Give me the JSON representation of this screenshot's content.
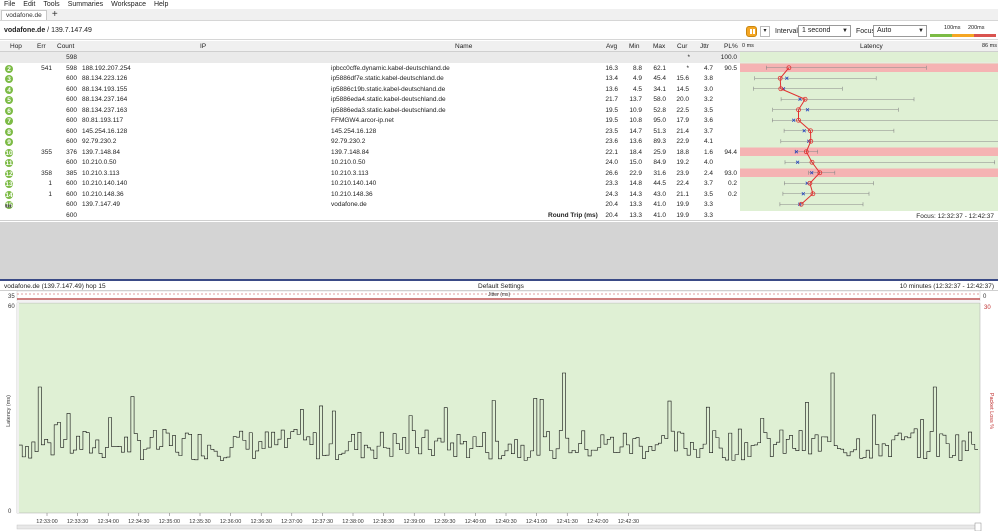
{
  "menu": [
    "File",
    "Edit",
    "Tools",
    "Summaries",
    "Workspace",
    "Help"
  ],
  "tabs": {
    "active": "vodafone.de",
    "add": "+"
  },
  "toolbar": {
    "target_host": "vodafone.de",
    "target_ip": " / 139.7.147.49",
    "pause_dropdown": "▾",
    "interval_label": "Interval",
    "interval_value": "1 second",
    "focus_label": "Focus",
    "focus_value": "Auto",
    "scale_100": "100ms",
    "scale_200": "200ms",
    "colors": {
      "good": "#7cbb45",
      "warn": "#f5a623",
      "bad": "#d9534f"
    }
  },
  "table": {
    "headers": {
      "hop": "Hop",
      "err": "Err",
      "count": "Count",
      "ip": "IP",
      "name": "Name",
      "avg": "Avg",
      "min": "Min",
      "max": "Max",
      "cur": "Cur",
      "jttr": "Jttr",
      "pl": "PL%",
      "latency": "Latency",
      "lat_min": "0 ms",
      "lat_max": "86 ms"
    },
    "first": {
      "count": "598",
      "cur": "*",
      "pl": "100.0"
    },
    "rows": [
      {
        "hop": "2",
        "err": "541",
        "count": "598",
        "ip": "188.192.207.254",
        "name": "ipbcc0cffe.dynamic.kabel-deutschland.de",
        "avg": "16.3",
        "min": "8.8",
        "max": "62.1",
        "cur": "*",
        "jttr": "4.7",
        "pl": "90.5"
      },
      {
        "hop": "3",
        "err": "",
        "count": "600",
        "ip": "88.134.223.126",
        "name": "ip5886df7e.static.kabel-deutschland.de",
        "avg": "13.4",
        "min": "4.9",
        "max": "45.4",
        "cur": "15.6",
        "jttr": "3.8",
        "pl": ""
      },
      {
        "hop": "4",
        "err": "",
        "count": "600",
        "ip": "88.134.193.155",
        "name": "ip5886c19b.static.kabel-deutschland.de",
        "avg": "13.6",
        "min": "4.5",
        "max": "34.1",
        "cur": "14.5",
        "jttr": "3.0",
        "pl": ""
      },
      {
        "hop": "5",
        "err": "",
        "count": "600",
        "ip": "88.134.237.164",
        "name": "ip5886eda4.static.kabel-deutschland.de",
        "avg": "21.7",
        "min": "13.7",
        "max": "58.0",
        "cur": "20.0",
        "jttr": "3.2",
        "pl": ""
      },
      {
        "hop": "6",
        "err": "",
        "count": "600",
        "ip": "88.134.237.163",
        "name": "ip5886eda3.static.kabel-deutschland.de",
        "avg": "19.5",
        "min": "10.9",
        "max": "52.8",
        "cur": "22.5",
        "jttr": "3.5",
        "pl": ""
      },
      {
        "hop": "7",
        "err": "",
        "count": "600",
        "ip": "80.81.193.117",
        "name": "FFMGW4.arcor-ip.net",
        "avg": "19.5",
        "min": "10.8",
        "max": "95.0",
        "cur": "17.9",
        "jttr": "3.6",
        "pl": ""
      },
      {
        "hop": "8",
        "err": "",
        "count": "600",
        "ip": "145.254.16.128",
        "name": "145.254.16.128",
        "avg": "23.5",
        "min": "14.7",
        "max": "51.3",
        "cur": "21.4",
        "jttr": "3.7",
        "pl": ""
      },
      {
        "hop": "9",
        "err": "",
        "count": "600",
        "ip": "92.79.230.2",
        "name": "92.79.230.2",
        "avg": "23.6",
        "min": "13.6",
        "max": "89.3",
        "cur": "22.9",
        "jttr": "4.1",
        "pl": ""
      },
      {
        "hop": "10",
        "err": "355",
        "count": "376",
        "ip": "139.7.148.84",
        "name": "139.7.148.84",
        "avg": "22.1",
        "min": "18.4",
        "max": "25.9",
        "cur": "18.8",
        "jttr": "1.6",
        "pl": "94.4"
      },
      {
        "hop": "11",
        "err": "",
        "count": "600",
        "ip": "10.210.0.50",
        "name": "10.210.0.50",
        "avg": "24.0",
        "min": "15.0",
        "max": "84.9",
        "cur": "19.2",
        "jttr": "4.0",
        "pl": ""
      },
      {
        "hop": "12",
        "err": "358",
        "count": "385",
        "ip": "10.210.3.113",
        "name": "10.210.3.113",
        "avg": "26.6",
        "min": "22.9",
        "max": "31.6",
        "cur": "23.9",
        "jttr": "2.4",
        "pl": "93.0"
      },
      {
        "hop": "13",
        "err": "1",
        "count": "600",
        "ip": "10.210.140.140",
        "name": "10.210.140.140",
        "avg": "23.3",
        "min": "14.8",
        "max": "44.5",
        "cur": "22.4",
        "jttr": "3.7",
        "pl": "0.2"
      },
      {
        "hop": "14",
        "err": "1",
        "count": "600",
        "ip": "10.210.148.36",
        "name": "10.210.148.36",
        "avg": "24.3",
        "min": "14.3",
        "max": "43.0",
        "cur": "21.1",
        "jttr": "3.5",
        "pl": "0.2"
      },
      {
        "hop": "15",
        "err": "",
        "count": "600",
        "ip": "139.7.147.49",
        "name": "vodafone.de",
        "avg": "20.4",
        "min": "13.3",
        "max": "41.0",
        "cur": "19.9",
        "jttr": "3.3",
        "pl": ""
      }
    ],
    "summary": {
      "count": "600",
      "label": "Round Trip (ms)",
      "avg": "20.4",
      "min": "13.3",
      "max": "41.0",
      "cur": "19.9",
      "jttr": "3.3"
    },
    "focus_range": "Focus: 12:32:37 - 12:42:37"
  },
  "graph": {
    "title_left": "vodafone.de (139.7.147.49) hop 15",
    "title_center": "Default Settings",
    "title_right": "10 minutes (12:32:37 - 12:42:37)",
    "jitter_label": "Jitter (ms)",
    "jitter_axis_left": "35",
    "jitter_axis_right": "0",
    "ylabel": "Latency (ms)",
    "ylabel_right": "Packet Loss %",
    "y_ticks": [
      "60",
      "0"
    ],
    "y_right_top": "30",
    "x_ticks": [
      "12:33:00",
      "12:33:30",
      "12:34:00",
      "12:34:30",
      "12:35:00",
      "12:35:30",
      "12:36:00",
      "12:36:30",
      "12:37:00",
      "12:37:30",
      "12:38:00",
      "12:38:30",
      "12:39:00",
      "12:39:30",
      "12:40:00",
      "12:40:30",
      "12:41:00",
      "12:41:30",
      "12:42:00",
      "12:42:30"
    ]
  },
  "chart_data": {
    "type": "line",
    "xlabel": "",
    "ylabel": "Latency (ms)",
    "ylim": [
      0,
      60
    ],
    "x_range": [
      "12:32:37",
      "12:42:37"
    ],
    "series": [
      {
        "values": []
      }
    ],
    "summary": {
      "avg": 20.4,
      "min": 13.3,
      "max": 41.0
    }
  }
}
